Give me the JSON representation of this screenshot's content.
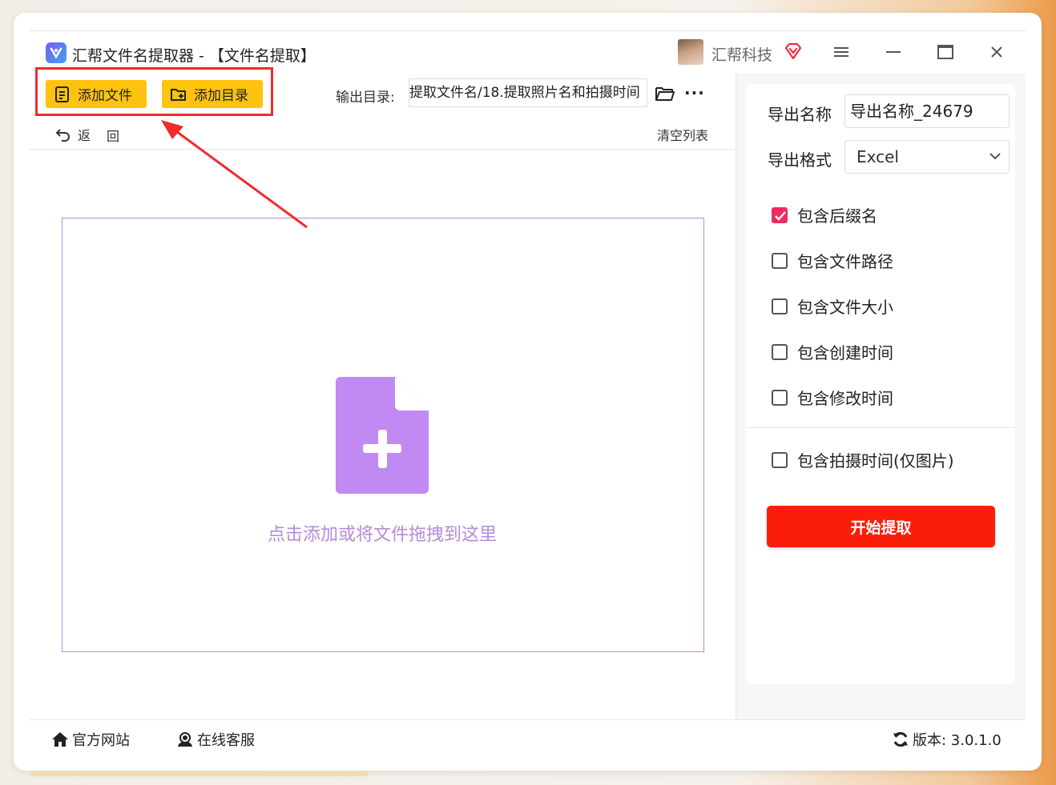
{
  "titlebar": {
    "app_title": "汇帮文件名提取器 - 【文件名提取】",
    "company": "汇帮科技"
  },
  "toolbar": {
    "add_file": "添加文件",
    "add_folder": "添加目录",
    "output_label": "输出目录:",
    "output_path": "提取文件名/18.提取照片名和拍摄时间",
    "more": "···",
    "undo": "返",
    "redo": "回",
    "clear_list": "清空列表"
  },
  "dropzone": {
    "hint": "点击添加或将文件拖拽到这里"
  },
  "settings": {
    "export_name_label": "导出名称",
    "export_name_value": "导出名称_24679",
    "export_format_label": "导出格式",
    "export_format_value": "Excel",
    "options": [
      {
        "label": "包含后缀名",
        "checked": true
      },
      {
        "label": "包含文件路径",
        "checked": false
      },
      {
        "label": "包含文件大小",
        "checked": false
      },
      {
        "label": "包含创建时间",
        "checked": false
      },
      {
        "label": "包含修改时间",
        "checked": false
      }
    ],
    "photo_option": {
      "label": "包含拍摄时间(仅图片)",
      "checked": false
    },
    "start_button": "开始提取"
  },
  "footer": {
    "website": "官方网站",
    "support": "在线客服",
    "version": "版本: 3.0.1.0"
  },
  "colors": {
    "accent_yellow": "#ffc20e",
    "start_red": "#fa1e0a",
    "check_pink": "#f0295f",
    "drop_purple": "#c08af2",
    "annotation_red": "#f02b2b"
  }
}
